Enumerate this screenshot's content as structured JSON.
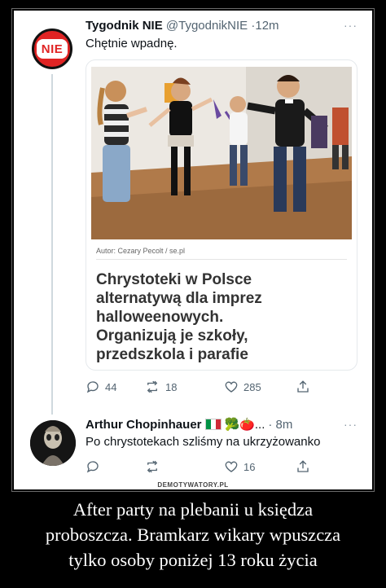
{
  "tweet1": {
    "author_name": "Tygodnik NIE",
    "handle": "@TygodnikNIE",
    "time": "12m",
    "avatar_text": "NIE",
    "text": "Chętnie wpadnę.",
    "more": "···",
    "quote": {
      "photo_credit": "Autor: Cezary Pecolt / se.pl",
      "headline": "Chrystoteki w Polsce\nalternatywą dla imprez\nhalloweenowych.\nOrganizują je szkoły,\nprzedszkola i parafie"
    },
    "stats": {
      "replies": "44",
      "retweets": "18",
      "likes": "285"
    }
  },
  "tweet2": {
    "author_name": "Arthur Chopinhauer",
    "emojis": "🥦🍅...",
    "time": "· 8m",
    "more": "···",
    "text": "Po chrystotekach szliśmy na ukrzyżowanko",
    "stats": {
      "replies": "",
      "retweets": "",
      "likes": "16"
    }
  },
  "watermark": "DEMOTYWATORY.PL",
  "caption": {
    "line1": "After party na plebanii u księdza",
    "line2": "proboszcza. Bramkarz wikary wpuszcza",
    "line3": "tylko osoby poniżej 13 roku życia"
  },
  "colors": {
    "nie_red": "#e02424",
    "twitter_gray": "#536471",
    "background": "#000000"
  }
}
